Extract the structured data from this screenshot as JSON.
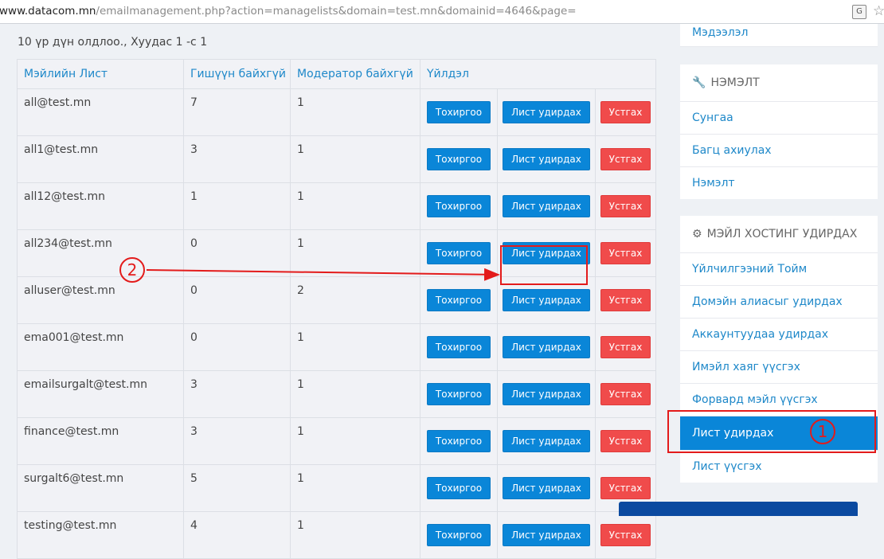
{
  "browser": {
    "url_host": "www.datacom.mn",
    "url_path": "/emailmanagement.php?action=managelists&domain=test.mn&domainid=4646&page="
  },
  "summary": "10 үр дүн олдлоо., Хуудас 1 -с 1",
  "table": {
    "headers": [
      "Мэйлийн Лист",
      "Гишүүн байхгүй",
      "Модератор байхгүй",
      "Үйлдэл"
    ],
    "action_labels": {
      "configure": "Тохиргоо",
      "manage": "Лист удирдах",
      "delete": "Устгах"
    },
    "rows": [
      {
        "name": "all@test.mn",
        "members": "7",
        "moderators": "1"
      },
      {
        "name": "all1@test.mn",
        "members": "3",
        "moderators": "1"
      },
      {
        "name": "all12@test.mn",
        "members": "1",
        "moderators": "1"
      },
      {
        "name": "all234@test.mn",
        "members": "0",
        "moderators": "1"
      },
      {
        "name": "alluser@test.mn",
        "members": "0",
        "moderators": "2"
      },
      {
        "name": "ema001@test.mn",
        "members": "0",
        "moderators": "1"
      },
      {
        "name": "emailsurgalt@test.mn",
        "members": "3",
        "moderators": "1"
      },
      {
        "name": "finance@test.mn",
        "members": "3",
        "moderators": "1"
      },
      {
        "name": "surgalt6@test.mn",
        "members": "5",
        "moderators": "1"
      },
      {
        "name": "testing@test.mn",
        "members": "4",
        "moderators": "1"
      }
    ]
  },
  "sidebar": {
    "top_item": "Мэдээлэл",
    "extra": {
      "title": "НЭМЭЛТ",
      "items": [
        "Сунгаа",
        "Багц ахиулах",
        "Нэмэлт"
      ]
    },
    "hosting": {
      "title": "МЭЙЛ ХОСТИНГ УДИРДАХ",
      "items": [
        "Үйлчилгээний Тойм",
        "Домэйн алиасыг удирдах",
        "Аккаунтуудаа удирдах",
        "Имэйл хаяг үүсгэх",
        "Форвард мэйл үүсгэх",
        "Лист удирдах",
        "Лист үүсгэх"
      ],
      "active_index": 5
    }
  },
  "annotations": {
    "marker_1": "1",
    "marker_2": "2"
  },
  "colors": {
    "primary": "#0a86d8",
    "danger": "#f04b4b",
    "annotation": "#e31b1b",
    "link": "#1e88c9"
  }
}
